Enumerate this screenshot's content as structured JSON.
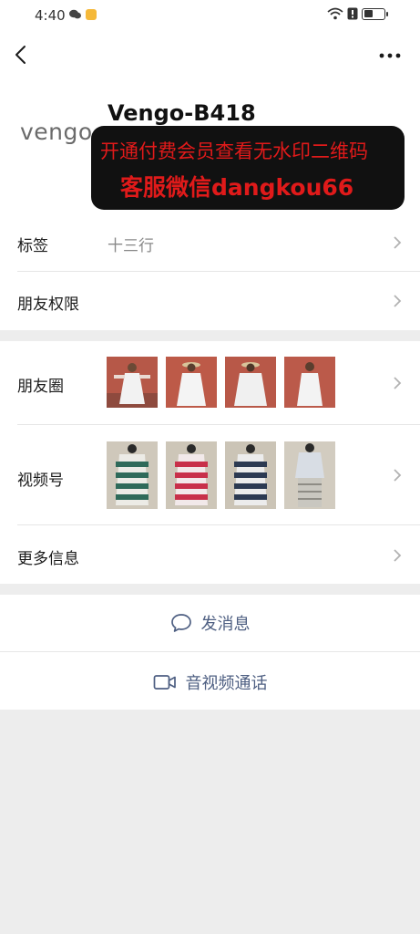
{
  "status_bar": {
    "time": "4:40"
  },
  "profile": {
    "logo_text": "vengo",
    "name": "Vengo-B418"
  },
  "watermark": {
    "line1": "开通付费会员查看无水印二维码",
    "line2": "客服微信dangkou66"
  },
  "rows": {
    "tags": {
      "label": "标签",
      "value": "十三行"
    },
    "permissions": {
      "label": "朋友权限"
    },
    "moments": {
      "label": "朋友圈",
      "thumbnails": 4
    },
    "channels": {
      "label": "视频号",
      "thumbnails": 4
    },
    "more_info": {
      "label": "更多信息"
    }
  },
  "actions": {
    "message": {
      "label": "发消息",
      "icon": "chat-bubble-icon"
    },
    "video_call": {
      "label": "音视频通话",
      "icon": "video-camera-icon"
    }
  },
  "colors": {
    "accent_text": "#4e5f82",
    "watermark_text": "#e01a1a",
    "background": "#ededed"
  }
}
